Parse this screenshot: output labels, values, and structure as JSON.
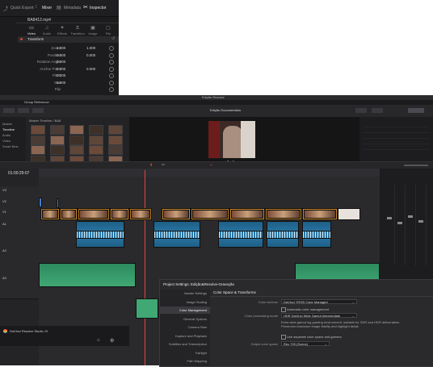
{
  "inspector": {
    "tabs": [
      "Quick Export",
      "Mixer",
      "Metadata",
      "Inspector"
    ],
    "clip_name": "BA8412.mp4",
    "subtabs": [
      "Video",
      "Audio",
      "Effects",
      "Transition",
      "Image",
      "File"
    ],
    "section": "Transform",
    "rows": [
      {
        "label": "Zoom",
        "x": "1.000",
        "y": "1.000"
      },
      {
        "label": "Position",
        "x": "0.000",
        "y": "0.000"
      },
      {
        "label": "Rotation Angle",
        "x": "0.000",
        "y": ""
      },
      {
        "label": "Anchor Point",
        "x": "0.000",
        "y": "0.000"
      },
      {
        "label": "Pitch",
        "x": "0.000",
        "y": ""
      },
      {
        "label": "Yaw",
        "x": "0.000",
        "y": ""
      },
      {
        "label": "Flip",
        "x": "",
        "y": ""
      }
    ]
  },
  "window": {
    "title": "Edição Resolve",
    "project_label": "Group Reference",
    "timecode": "01:00:29:07",
    "viewer_title": "Edição Documentário",
    "media_pool_title": "Master Timeline / BA8",
    "bins": [
      "Master",
      "Timeline",
      "Audio",
      "Video",
      "Smart Bins"
    ]
  },
  "project_settings": {
    "title": "Project Settings: Edição&Resolve-Gravação",
    "nav": [
      "Master Settings",
      "Image Scaling",
      "Color Management",
      "General Options",
      "Camera Raw",
      "Capture and Playback",
      "Subtitles and Transcription",
      "Fairlight",
      "Path Mapping"
    ],
    "active_nav": "Color Management",
    "section_title": "Color Space & Transforms",
    "fields": {
      "color_science_label": "Color science",
      "color_science": "DaVinci YRGB Color Managed",
      "auto_color_mgmt": "Automatic color management",
      "processing_mode_label": "Color processing mode",
      "processing_mode": "HDR DaVinci Wide Gamut Intermediate",
      "description": "Extra wide gamut log grading environment, suitable for SDR and HDR deliverables. Preserves maximum image fidelity and highlight detail.",
      "separate_color_space": "Use separate color space and gamma",
      "output_color_space_label": "Output color space",
      "output_color_space": "Rec.709 (Scene)"
    }
  },
  "status": {
    "app_name": "DaVinci Resolve Studio 19"
  }
}
